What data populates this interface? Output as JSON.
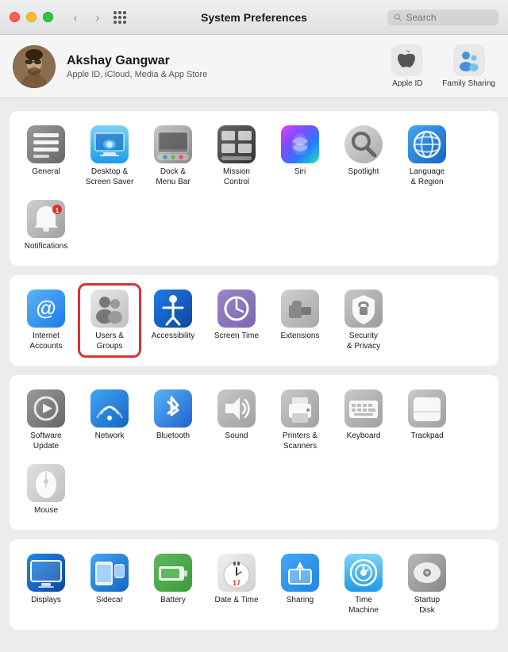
{
  "titleBar": {
    "title": "System Preferences",
    "searchPlaceholder": "Search"
  },
  "profile": {
    "name": "Akshay Gangwar",
    "subtitle": "Apple ID, iCloud, Media & App Store",
    "appleIdLabel": "Apple ID",
    "familySharingLabel": "Family Sharing"
  },
  "sections": [
    {
      "id": "section1",
      "items": [
        {
          "id": "general",
          "label": "General",
          "icon": "general",
          "emoji": "⚙️"
        },
        {
          "id": "desktop",
          "label": "Desktop &\nScreen Saver",
          "icon": "desktop",
          "emoji": "🖼️"
        },
        {
          "id": "dock",
          "label": "Dock &\nMenu Bar",
          "icon": "dock",
          "emoji": "🪟"
        },
        {
          "id": "mission",
          "label": "Mission\nControl",
          "icon": "mission",
          "emoji": "▦"
        },
        {
          "id": "siri",
          "label": "Siri",
          "icon": "siri",
          "emoji": "🎙️"
        },
        {
          "id": "spotlight",
          "label": "Spotlight",
          "icon": "spotlight",
          "emoji": "🔍"
        },
        {
          "id": "language",
          "label": "Language\n& Region",
          "icon": "language",
          "emoji": "🌐"
        },
        {
          "id": "notifications",
          "label": "Notifications",
          "icon": "notifications",
          "emoji": "🔔",
          "badge": "1"
        }
      ]
    },
    {
      "id": "section2",
      "items": [
        {
          "id": "internet",
          "label": "Internet\nAccounts",
          "icon": "internet",
          "emoji": "@",
          "highlighted": false
        },
        {
          "id": "users",
          "label": "Users &\nGroups",
          "icon": "users",
          "emoji": "👥",
          "highlighted": true
        },
        {
          "id": "accessibility",
          "label": "Accessibility",
          "icon": "accessibility",
          "emoji": "♿"
        },
        {
          "id": "screentime",
          "label": "Screen Time",
          "icon": "screentime",
          "emoji": "⏳"
        },
        {
          "id": "extensions",
          "label": "Extensions",
          "icon": "extensions",
          "emoji": "🏠"
        },
        {
          "id": "security",
          "label": "Security\n& Privacy",
          "icon": "security",
          "emoji": "🔒"
        }
      ]
    },
    {
      "id": "section3",
      "items": [
        {
          "id": "software",
          "label": "Software\nUpdate",
          "icon": "software",
          "emoji": "⚙️"
        },
        {
          "id": "network",
          "label": "Network",
          "icon": "network",
          "emoji": "🌐"
        },
        {
          "id": "bluetooth",
          "label": "Bluetooth",
          "icon": "bluetooth",
          "emoji": "₿"
        },
        {
          "id": "sound",
          "label": "Sound",
          "icon": "sound",
          "emoji": "🔊"
        },
        {
          "id": "printers",
          "label": "Printers &\nScanners",
          "icon": "printers",
          "emoji": "🖨️"
        },
        {
          "id": "keyboard",
          "label": "Keyboard",
          "icon": "keyboard",
          "emoji": "⌨️"
        },
        {
          "id": "trackpad",
          "label": "Trackpad",
          "icon": "trackpad",
          "emoji": "▭"
        },
        {
          "id": "mouse",
          "label": "Mouse",
          "icon": "mouse",
          "emoji": "🖱️"
        }
      ]
    },
    {
      "id": "section4",
      "items": [
        {
          "id": "displays",
          "label": "Displays",
          "icon": "displays",
          "emoji": "🖥️"
        },
        {
          "id": "sidecar",
          "label": "Sidecar",
          "icon": "sidecar",
          "emoji": "📱"
        },
        {
          "id": "battery",
          "label": "Battery",
          "icon": "battery",
          "emoji": "🔋"
        },
        {
          "id": "datetime",
          "label": "Date & Time",
          "icon": "datetime",
          "emoji": "📅"
        },
        {
          "id": "sharing",
          "label": "Sharing",
          "icon": "sharing",
          "emoji": "📁"
        },
        {
          "id": "timemachine",
          "label": "Time\nMachine",
          "icon": "timemachine",
          "emoji": "🕐"
        },
        {
          "id": "startup",
          "label": "Startup\nDisk",
          "icon": "startup",
          "emoji": "💾"
        }
      ]
    }
  ]
}
